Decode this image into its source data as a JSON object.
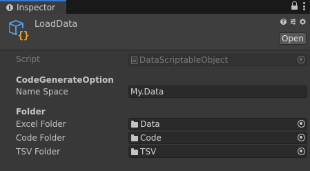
{
  "tab": {
    "title": "Inspector",
    "icons": [
      "info-icon",
      "lock-icon",
      "more-icon"
    ]
  },
  "header": {
    "asset_name": "LoadData",
    "open_label": "Open",
    "icons": [
      "scriptable-object-icon",
      "help-icon",
      "presets-icon",
      "settings-icon"
    ]
  },
  "script": {
    "label": "Script",
    "value": "DataScriptableObject"
  },
  "code_generate": {
    "title": "CodeGenerateOption",
    "name_space_label": "Name Space",
    "name_space_value": "My.Data"
  },
  "folder": {
    "title": "Folder",
    "excel_label": "Excel Folder",
    "excel_value": "Data",
    "code_label": "Code Folder",
    "code_value": "Code",
    "tsv_label": "TSV Folder",
    "tsv_value": "TSV"
  },
  "colors": {
    "tab_accent": "#3a79bb",
    "asset_icon_blue": "#4c9ee6",
    "asset_icon_orange": "#f5a623"
  }
}
